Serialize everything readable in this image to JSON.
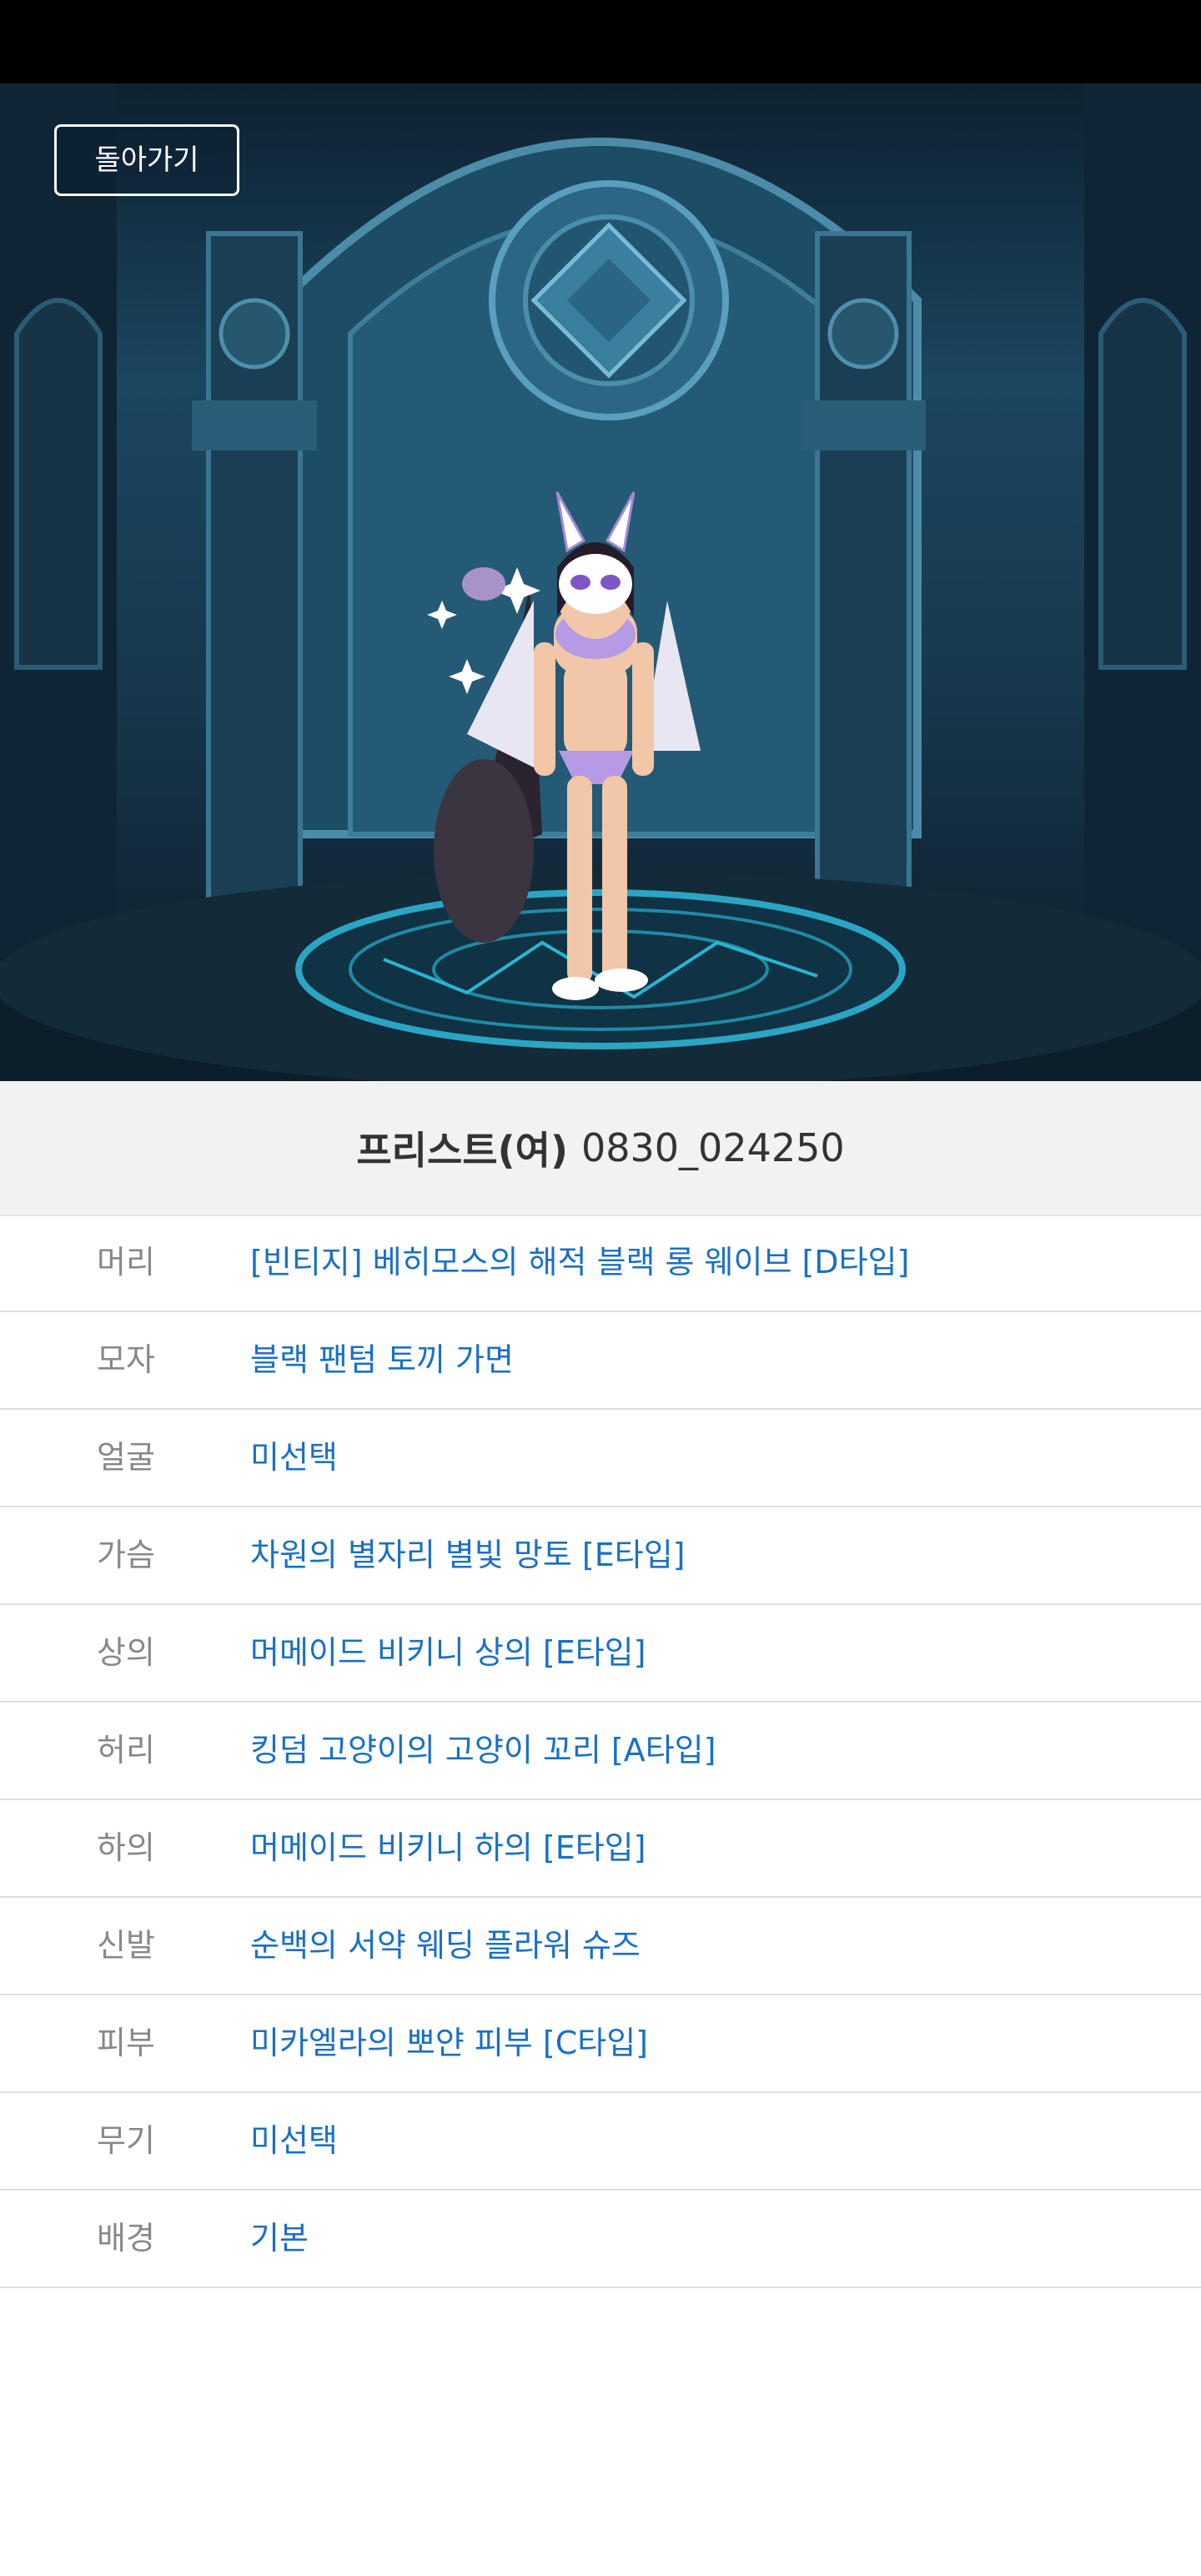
{
  "header": {
    "back_label": "돌아가기"
  },
  "title": {
    "class_name": "프리스트(여)",
    "code": "0830_024250"
  },
  "items": [
    {
      "label": "머리",
      "value": "[빈티지] 베히모스의 해적 블랙 롱 웨이브 [D타입]"
    },
    {
      "label": "모자",
      "value": "블랙 팬텀 토끼 가면"
    },
    {
      "label": "얼굴",
      "value": "미선택"
    },
    {
      "label": "가슴",
      "value": "차원의 별자리 별빛 망토 [E타입]"
    },
    {
      "label": "상의",
      "value": "머메이드 비키니 상의 [E타입]"
    },
    {
      "label": "허리",
      "value": "킹덤 고양이의 고양이 꼬리 [A타입]"
    },
    {
      "label": "하의",
      "value": "머메이드 비키니 하의 [E타입]"
    },
    {
      "label": "신발",
      "value": "순백의 서약 웨딩 플라워 슈즈"
    },
    {
      "label": "피부",
      "value": "미카엘라의 뽀얀 피부 [C타입]"
    },
    {
      "label": "무기",
      "value": "미선택"
    },
    {
      "label": "배경",
      "value": "기본"
    }
  ],
  "colors": {
    "value_text": "#1a6fc8",
    "label_text": "#888888",
    "title_bg": "#f2f2f2"
  }
}
